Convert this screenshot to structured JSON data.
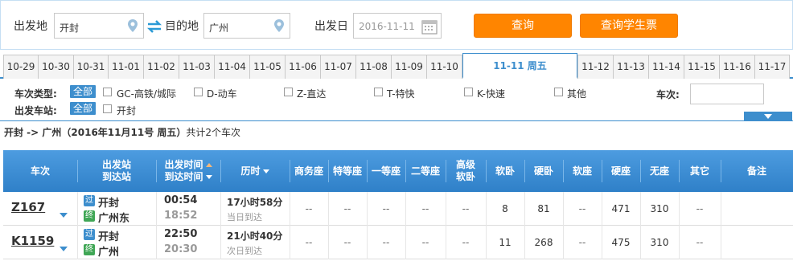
{
  "search": {
    "from_label": "出发地",
    "from_value": "开封",
    "to_label": "目的地",
    "to_value": "广州",
    "date_label": "出发日",
    "date_value": "2016-11-11",
    "query_button": "查询",
    "student_button": "查询学生票",
    "accent_color": "#ff8500"
  },
  "date_tabs": [
    {
      "label": "10-29"
    },
    {
      "label": "10-30"
    },
    {
      "label": "10-31"
    },
    {
      "label": "11-01"
    },
    {
      "label": "11-02"
    },
    {
      "label": "11-03"
    },
    {
      "label": "11-04"
    },
    {
      "label": "11-05"
    },
    {
      "label": "11-06"
    },
    {
      "label": "11-07"
    },
    {
      "label": "11-08"
    },
    {
      "label": "11-09"
    },
    {
      "label": "11-10"
    },
    {
      "label": "11-11 周五",
      "active": true
    },
    {
      "label": "11-12"
    },
    {
      "label": "11-13"
    },
    {
      "label": "11-14"
    },
    {
      "label": "11-15"
    },
    {
      "label": "11-16"
    },
    {
      "label": "11-17"
    }
  ],
  "filters": {
    "train_type_label": "车次类型:",
    "all_label": "全部",
    "types": [
      "GC-高铁/城际",
      "D-动车",
      "Z-直达",
      "T-特快",
      "K-快速",
      "其他"
    ],
    "station_label": "出发车站:",
    "stations": [
      "开封"
    ],
    "train_no_label": "车次:"
  },
  "summary": {
    "route": "开封 -> 广州（2016年11月11号  周五）",
    "count_text": "共计2个车次"
  },
  "table": {
    "headers": {
      "train": "车次",
      "station_line1": "出发站",
      "station_line2": "到达站",
      "time_line1": "出发时间",
      "time_line2": "到达时间",
      "duration": "历时",
      "business": "商务座",
      "special": "特等座",
      "first": "一等座",
      "second": "二等座",
      "adv_soft_line1": "高级",
      "adv_soft_line2": "软卧",
      "soft_sleeper": "软卧",
      "hard_sleeper": "硬卧",
      "soft_seat": "软座",
      "hard_seat": "硬座",
      "no_seat": "无座",
      "other": "其它",
      "remark": "备注"
    },
    "rows": [
      {
        "train_no": "Z167",
        "from_icon": "过",
        "from_station": "开封",
        "to_icon": "终",
        "to_station": "广州东",
        "depart": "00:54",
        "arrive": "18:52",
        "duration": "17小时58分",
        "arrive_note": "当日到达",
        "business": "--",
        "special": "--",
        "first": "--",
        "second": "--",
        "adv_soft": "--",
        "soft_sleeper": "8",
        "hard_sleeper": "81",
        "soft_seat": "--",
        "hard_seat": "471",
        "no_seat": "310",
        "other": "--",
        "remark": ""
      },
      {
        "train_no": "K1159",
        "from_icon": "过",
        "from_station": "开封",
        "to_icon": "终",
        "to_station": "广州",
        "depart": "22:50",
        "arrive": "20:30",
        "duration": "21小时40分",
        "arrive_note": "次日到达",
        "business": "--",
        "special": "--",
        "first": "--",
        "second": "--",
        "adv_soft": "--",
        "soft_sleeper": "11",
        "hard_sleeper": "268",
        "soft_seat": "--",
        "hard_seat": "475",
        "no_seat": "310",
        "other": "--",
        "remark": ""
      }
    ]
  }
}
